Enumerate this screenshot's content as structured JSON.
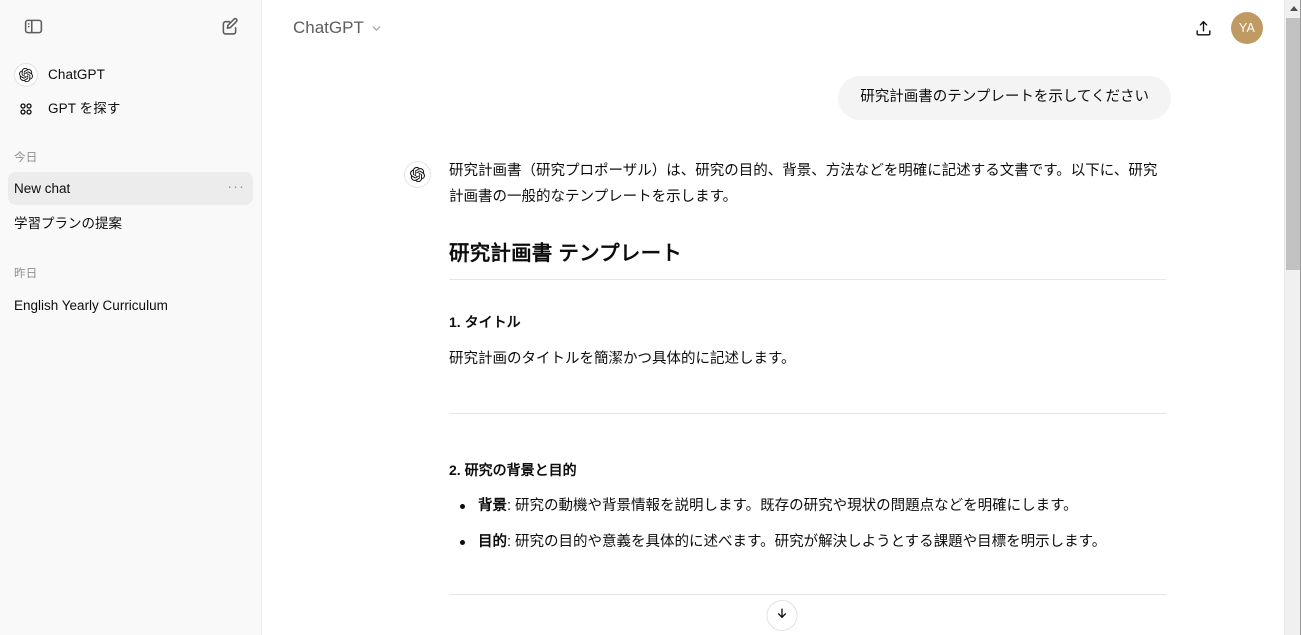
{
  "sidebar": {
    "toggle_icon": "sidebar-panel-icon",
    "new_chat_icon": "new-chat-pencil-icon",
    "nav": [
      {
        "label": "ChatGPT",
        "icon": "openai-logo-icon"
      },
      {
        "label": "GPT を探す",
        "icon": "grid-apps-icon"
      }
    ],
    "groups": [
      {
        "heading": "今日",
        "chats": [
          {
            "title": "New chat",
            "active": true,
            "menu": "···"
          },
          {
            "title": "学習プランの提案",
            "active": false
          }
        ]
      },
      {
        "heading": "昨日",
        "chats": [
          {
            "title": "English Yearly Curriculum",
            "active": false
          }
        ]
      }
    ]
  },
  "topbar": {
    "model_name": "ChatGPT",
    "chevron_icon": "chevron-down-icon",
    "share_icon": "share-upload-icon",
    "avatar_initials": "YA",
    "avatar_color": "#bf9b63"
  },
  "conversation": {
    "user_message": "研究計画書のテンプレートを示してください",
    "assistant": {
      "avatar_icon": "openai-logo-icon",
      "intro": "研究計画書（研究プロポーザル）は、研究の目的、背景、方法などを明確に記述する文書です。以下に、研究計画書の一般的なテンプレートを示します。",
      "doc_title": "研究計画書 テンプレート",
      "sections": [
        {
          "heading": "1. タイトル",
          "description": "研究計画のタイトルを簡潔かつ具体的に記述します。"
        },
        {
          "heading": "2. 研究の背景と目的",
          "bullets": [
            {
              "term": "背景",
              "text": ": 研究の動機や背景情報を説明します。既存の研究や現状の問題点などを明確にします。"
            },
            {
              "term": "目的",
              "text": ": 研究の目的や意義を具体的に述べます。研究が解決しようとする課題や目標を明示します。"
            }
          ]
        }
      ]
    },
    "scroll_button_icon": "arrow-down-icon"
  },
  "scrollbar": {
    "up_arrow_icon": "scroll-up-arrow-icon"
  }
}
